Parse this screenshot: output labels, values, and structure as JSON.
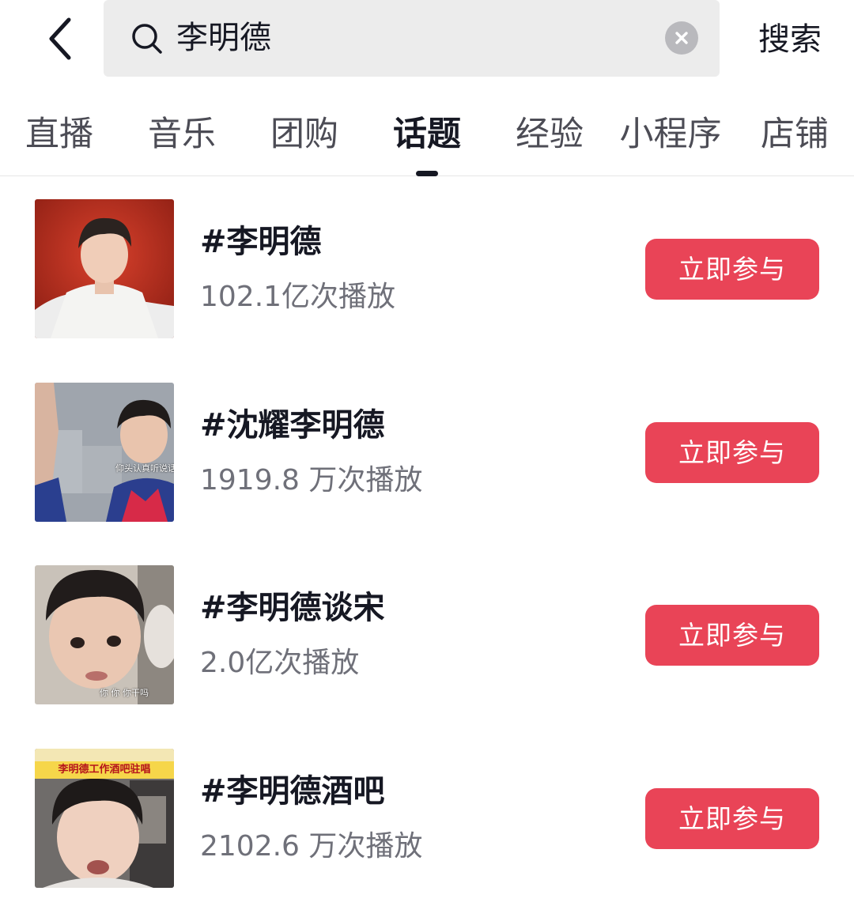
{
  "search": {
    "query": "李明德",
    "submit_label": "搜索"
  },
  "tabs": [
    {
      "label": "直播",
      "active": false
    },
    {
      "label": "音乐",
      "active": false
    },
    {
      "label": "团购",
      "active": false
    },
    {
      "label": "话题",
      "active": true
    },
    {
      "label": "经验",
      "active": false
    },
    {
      "label": "小程序",
      "active": false
    },
    {
      "label": "店铺",
      "active": false
    }
  ],
  "topics": [
    {
      "title": "#李明德",
      "plays": "102.1亿次播放",
      "button": "立即参与",
      "thumb_caption": ""
    },
    {
      "title": "#沈耀李明德",
      "plays": "1919.8 万次播放",
      "button": "立即参与",
      "thumb_caption": "仰头认真听说话"
    },
    {
      "title": "#李明德谈宋",
      "plays": "2.0亿次播放",
      "button": "立即参与",
      "thumb_caption": "你 你 你干吗"
    },
    {
      "title": "#李明德酒吧",
      "plays": "2102.6 万次播放",
      "button": "立即参与",
      "thumb_caption": "李明德工作酒吧驻唱"
    }
  ],
  "colors": {
    "accent_button": "#e94457",
    "search_bg": "#ececec"
  },
  "icons": [
    "back-arrow-icon",
    "search-icon",
    "clear-icon"
  ]
}
